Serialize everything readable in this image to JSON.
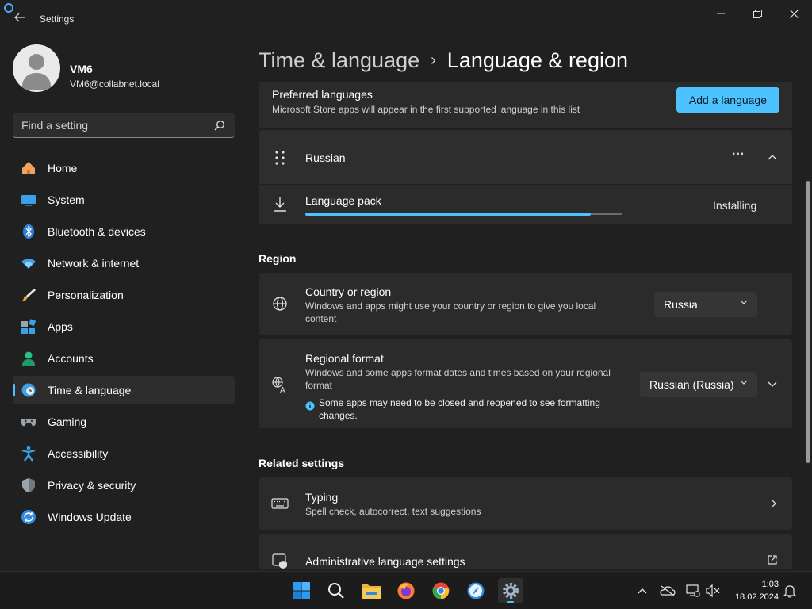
{
  "window": {
    "title": "Settings"
  },
  "profile": {
    "name": "VM6",
    "email": "VM6@collabnet.local"
  },
  "search": {
    "placeholder": "Find a setting"
  },
  "nav": {
    "items": [
      {
        "label": "Home",
        "icon": "home-icon"
      },
      {
        "label": "System",
        "icon": "system-icon"
      },
      {
        "label": "Bluetooth & devices",
        "icon": "bluetooth-icon"
      },
      {
        "label": "Network & internet",
        "icon": "network-icon"
      },
      {
        "label": "Personalization",
        "icon": "brush-icon"
      },
      {
        "label": "Apps",
        "icon": "apps-icon"
      },
      {
        "label": "Accounts",
        "icon": "accounts-icon"
      },
      {
        "label": "Time & language",
        "icon": "time-language-icon",
        "active": true
      },
      {
        "label": "Gaming",
        "icon": "gamepad-icon"
      },
      {
        "label": "Accessibility",
        "icon": "accessibility-icon"
      },
      {
        "label": "Privacy & security",
        "icon": "shield-icon"
      },
      {
        "label": "Windows Update",
        "icon": "update-icon"
      }
    ]
  },
  "breadcrumb": {
    "parent": "Time & language",
    "separator": "›",
    "current": "Language & region"
  },
  "preferred_languages": {
    "title": "Preferred languages",
    "description": "Microsoft Store apps will appear in the first supported language in this list",
    "add_button": "Add a language"
  },
  "russian": {
    "label": "Russian",
    "more": "···"
  },
  "language_pack": {
    "label": "Language pack",
    "status": "Installing",
    "progress": 0.9
  },
  "region": {
    "heading": "Region",
    "country": {
      "title": "Country or region",
      "description": "Windows and apps might use your country or region to give you local content",
      "value": "Russia"
    },
    "format": {
      "title": "Regional format",
      "description": "Windows and some apps format dates and times based on your regional format",
      "note": "Some apps may need to be closed and reopened to see formatting changes.",
      "value": "Russian (Russia)"
    }
  },
  "related": {
    "heading": "Related settings",
    "typing": {
      "title": "Typing",
      "description": "Spell check, autocorrect, text suggestions"
    },
    "admin": {
      "title": "Administrative language settings"
    }
  },
  "taskbar": {
    "time": "1:03",
    "date": "18.02.2024"
  },
  "colors": {
    "accent": "#4cc2ff",
    "background": "#202020",
    "card": "#2b2b2b"
  }
}
